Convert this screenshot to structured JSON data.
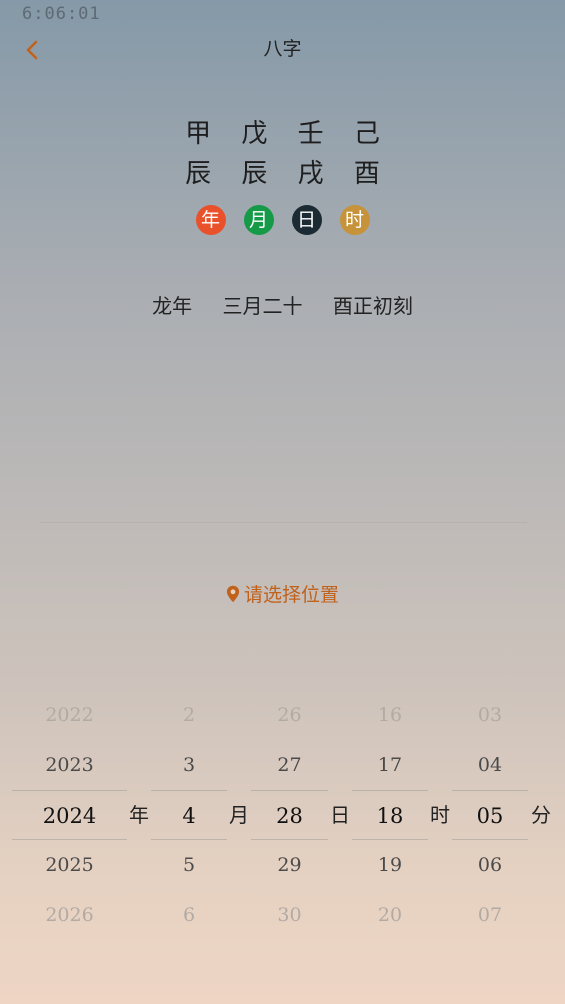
{
  "status_bar": {
    "time": "6:06:01"
  },
  "nav": {
    "title": "八字",
    "back_icon": "chevron-left-icon"
  },
  "bazi": {
    "stems": [
      "甲",
      "戊",
      "壬",
      "己"
    ],
    "branches": [
      "辰",
      "辰",
      "戌",
      "酉"
    ],
    "pillars": [
      {
        "label": "年",
        "color": "#e9512a"
      },
      {
        "label": "月",
        "color": "#159a48"
      },
      {
        "label": "日",
        "color": "#1c2a33"
      },
      {
        "label": "时",
        "color": "#c6933a"
      }
    ]
  },
  "lunar_date": {
    "year": "龙年",
    "day": "三月二十",
    "hour": "酉正初刻"
  },
  "location": {
    "text": "请选择位置",
    "icon": "map-pin-icon",
    "color": "#c0621c"
  },
  "picker": {
    "year": {
      "items": [
        "2022",
        "2023",
        "2024",
        "2025",
        "2026"
      ],
      "unit": "年"
    },
    "month": {
      "items": [
        "2",
        "3",
        "4",
        "5",
        "6"
      ],
      "unit": "月"
    },
    "day": {
      "items": [
        "26",
        "27",
        "28",
        "29",
        "30"
      ],
      "unit": "日"
    },
    "hour": {
      "items": [
        "16",
        "17",
        "18",
        "19",
        "20"
      ],
      "unit": "时"
    },
    "minute": {
      "items": [
        "03",
        "04",
        "05",
        "06",
        "07"
      ],
      "unit": "分"
    }
  }
}
